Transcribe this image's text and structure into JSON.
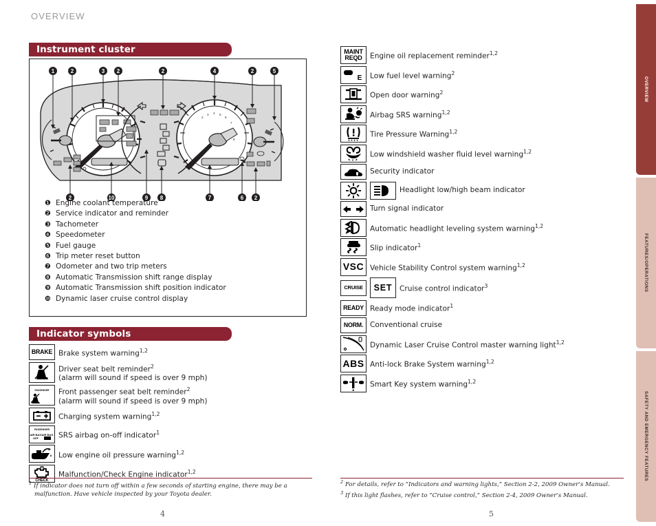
{
  "running_head": "OVERVIEW",
  "side_tabs": [
    {
      "label": "OVERVIEW",
      "active": true,
      "bg": "#973d38",
      "fg": "#ffffff"
    },
    {
      "label": "FEATURES/OPERATIONS",
      "active": false,
      "bg": "#dfbfb4",
      "fg": "#3a2b28"
    },
    {
      "label": "SAFETY AND EMERGENCY FEATURES",
      "active": false,
      "bg": "#dfbfb4",
      "fg": "#3a2b28"
    }
  ],
  "theme": {
    "banner_bg": "#8b2332",
    "banner_fg": "#ffffff",
    "rule_color": "#8b2332",
    "text": "#231f20",
    "running_head_color": "#9a9a9a"
  },
  "left_column": {
    "section_title": "Instrument cluster",
    "diagram": {
      "name": "instrument-cluster-diagram",
      "callout_numbers_top": [
        "1",
        "2",
        "3",
        "2",
        "2",
        "4",
        "2",
        "5"
      ],
      "callout_numbers_bottom": [
        "2",
        "10",
        "9",
        "8",
        "7",
        "6",
        "2"
      ]
    },
    "legend": [
      {
        "num": "❶",
        "text": "Engine coolant temperature"
      },
      {
        "num": "❷",
        "text": "Service indicator and reminder"
      },
      {
        "num": "❸",
        "text": "Tachometer"
      },
      {
        "num": "❹",
        "text": "Speedometer"
      },
      {
        "num": "❺",
        "text": "Fuel gauge"
      },
      {
        "num": "❻",
        "text": "Trip meter reset button"
      },
      {
        "num": "❼",
        "text": "Odometer and two trip meters"
      },
      {
        "num": "❽",
        "text": "Automatic Transmission shift range display"
      },
      {
        "num": "❾",
        "text": "Automatic Transmission shift position indicator"
      },
      {
        "num": "❿",
        "text": "Dynamic laser cruise control display"
      }
    ],
    "indicator_section_title": "Indicator symbols",
    "indicators": [
      {
        "icon": "brake-warning-icon",
        "icon_text": "BRAKE",
        "label": "Brake system warning",
        "sup": "1,2",
        "label2": ""
      },
      {
        "icon": "driver-seat-belt-reminder-icon",
        "icon_text": "",
        "label": "Driver seat belt reminder",
        "sup": "2",
        "label2": "(alarm will sound if speed is over 9 mph)"
      },
      {
        "icon": "front-passenger-seat-belt-reminder-icon",
        "icon_text": "",
        "label": "Front passenger seat belt reminder",
        "sup": "2",
        "label2": "(alarm will sound if speed is over 9 mph)"
      },
      {
        "icon": "charging-system-warning-icon",
        "icon_text": "",
        "label": "Charging system warning",
        "sup": "1,2",
        "label2": ""
      },
      {
        "icon": "srs-airbag-on-off-icon",
        "icon_text": "",
        "label": "SRS airbag on-off indicator",
        "sup": "1",
        "label2": ""
      },
      {
        "icon": "low-engine-oil-pressure-icon",
        "icon_text": "",
        "label": "Low engine oil pressure warning",
        "sup": "1,2",
        "label2": ""
      },
      {
        "icon": "check-engine-icon",
        "icon_text": "CHECK",
        "label": "Malfunction/Check Engine indicator",
        "sup": "1,2",
        "label2": ""
      }
    ]
  },
  "right_column": {
    "indicators": [
      {
        "icon": "maint-reqd-icon",
        "icon_text": "MAINT REQD",
        "label": "Engine oil replacement reminder",
        "sup": "1,2",
        "icon2": ""
      },
      {
        "icon": "low-fuel-level-icon",
        "icon_text": "E",
        "label": "Low fuel level warning",
        "sup": "2",
        "icon2": ""
      },
      {
        "icon": "open-door-warning-icon",
        "icon_text": "",
        "label": "Open door warning",
        "sup": "2",
        "icon2": ""
      },
      {
        "icon": "airbag-srs-warning-icon",
        "icon_text": "",
        "label": "Airbag SRS warning",
        "sup": "1,2",
        "icon2": ""
      },
      {
        "icon": "tire-pressure-warning-icon",
        "icon_text": "",
        "label": "Tire Pressure Warning",
        "sup": "1,2",
        "icon2": ""
      },
      {
        "icon": "low-washer-fluid-icon",
        "icon_text": "",
        "label": "Low windshield washer fluid level warning",
        "sup": "1,2",
        "icon2": ""
      },
      {
        "icon": "security-indicator-icon",
        "icon_text": "",
        "label": "Security indicator",
        "sup": "",
        "icon2": ""
      },
      {
        "icon": "headlight-low-beam-icon",
        "icon_text": "",
        "label": "Headlight low/high beam indicator",
        "sup": "",
        "icon2": "headlight-high-beam-icon"
      },
      {
        "icon": "turn-signal-icon",
        "icon_text": "",
        "label": "Turn signal indicator",
        "sup": "",
        "icon2": ""
      },
      {
        "icon": "auto-headlight-leveling-icon",
        "icon_text": "",
        "label": "Automatic headlight leveling system warning",
        "sup": "1,2",
        "icon2": ""
      },
      {
        "icon": "slip-indicator-icon",
        "icon_text": "",
        "label": "Slip indicator",
        "sup": "1",
        "icon2": ""
      },
      {
        "icon": "vsc-warning-icon",
        "icon_text": "VSC",
        "label": "Vehicle Stability Control system warning",
        "sup": "1,2",
        "icon2": ""
      },
      {
        "icon": "cruise-indicator-icon",
        "icon_text": "CRUISE",
        "label": "Cruise control indicator",
        "sup": "3",
        "icon2": "set-indicator-icon",
        "icon2_text": "SET"
      },
      {
        "icon": "ready-mode-icon",
        "icon_text": "READY",
        "label": "Ready mode indicator",
        "sup": "1",
        "icon2": ""
      },
      {
        "icon": "conventional-cruise-icon",
        "icon_text": "NORM.",
        "label": "Conventional cruise",
        "sup": "",
        "icon2": ""
      },
      {
        "icon": "dynamic-laser-cruise-master-warning-icon",
        "icon_text": "",
        "label": "Dynamic Laser Cruise Control master warning light",
        "sup": "1,2",
        "icon2": ""
      },
      {
        "icon": "abs-warning-icon",
        "icon_text": "ABS",
        "label": "Anti-lock Brake System warning",
        "sup": "1,2",
        "icon2": ""
      },
      {
        "icon": "smart-key-warning-icon",
        "icon_text": "",
        "label": "Smart Key system warning",
        "sup": "1,2",
        "icon2": ""
      }
    ]
  },
  "footnotes": {
    "left": {
      "marker": "1",
      "line1": "If indicator does not turn off within a few seconds of starting engine, there may be a",
      "line2": "malfunction. Have vehicle inspected by your Toyota dealer."
    },
    "right": [
      {
        "marker": "2",
        "text": "For details, refer to “Indicators and warning lights,” Section 2-2, 2009 Owner’s Manual."
      },
      {
        "marker": "3",
        "text": "If this light flashes, refer to “Cruise control,” Section 2-4, 2009 Owner’s Manual."
      }
    ]
  },
  "page_numbers": {
    "left": "4",
    "right": "5"
  }
}
